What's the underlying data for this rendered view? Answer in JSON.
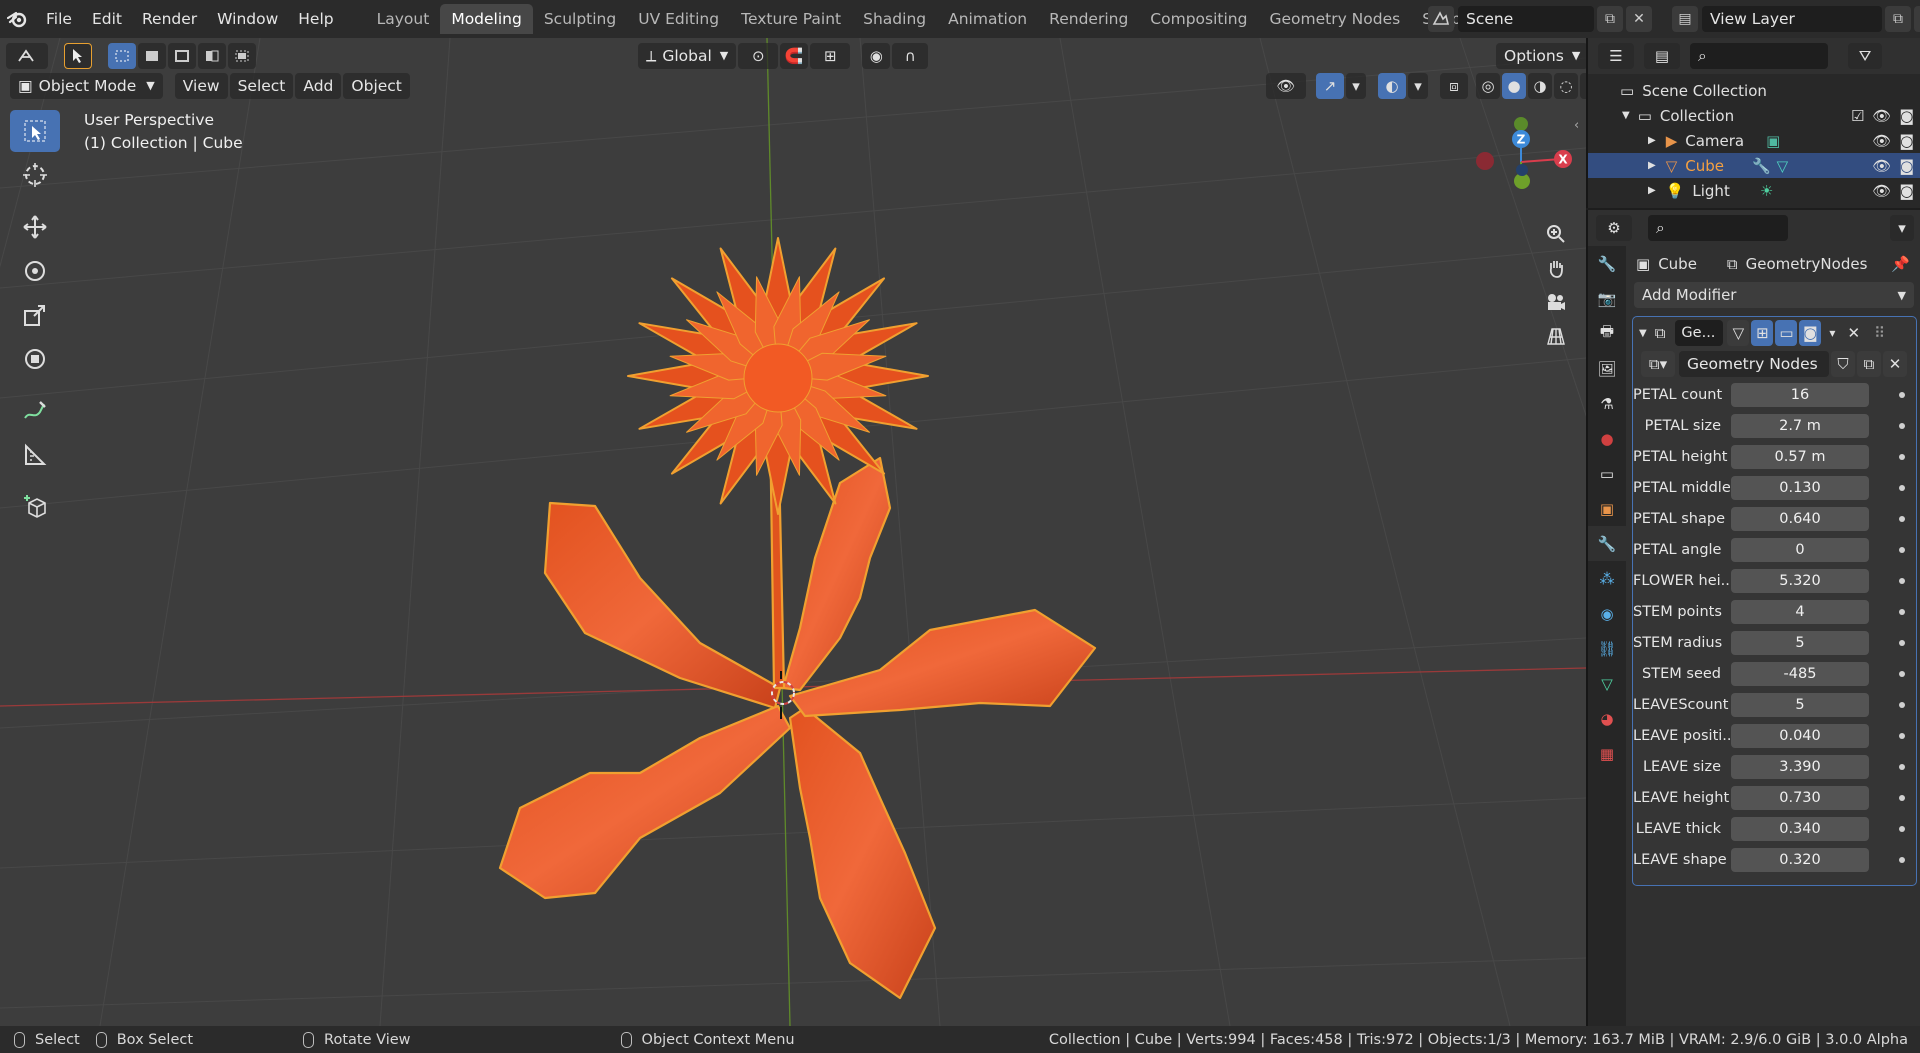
{
  "menubar": {
    "items": [
      "File",
      "Edit",
      "Render",
      "Window",
      "Help"
    ],
    "workspaces": [
      "Layout",
      "Modeling",
      "Sculpting",
      "UV Editing",
      "Texture Paint",
      "Shading",
      "Animation",
      "Rendering",
      "Compositing",
      "Geometry Nodes",
      "Scripting"
    ],
    "active_workspace": "Modeling",
    "add_workspace": "+",
    "scene_name": "Scene",
    "view_layer": "View Layer"
  },
  "viewport": {
    "transform_orientation": "Global",
    "options_label": "Options",
    "mode": "Object Mode",
    "menus": [
      "View",
      "Select",
      "Add",
      "Object"
    ],
    "overlay_line1": "User Perspective",
    "overlay_line2": "(1) Collection | Cube",
    "gizmo_axes": {
      "z": "Z",
      "x": "X"
    }
  },
  "outliner": {
    "root": "Scene Collection",
    "collection": "Collection",
    "objects": [
      {
        "name": "Camera",
        "selected": false
      },
      {
        "name": "Cube",
        "selected": true
      },
      {
        "name": "Light",
        "selected": false
      }
    ]
  },
  "properties": {
    "object_name": "Cube",
    "modifier_tab": "GeometryNodes",
    "add_modifier": "Add Modifier",
    "modifier_short_name": "Ge...",
    "node_group": "Geometry Nodes",
    "inputs": [
      {
        "label": "PETAL count",
        "value": "16"
      },
      {
        "label": "PETAL size",
        "value": "2.7 m"
      },
      {
        "label": "PETAL height",
        "value": "0.57 m"
      },
      {
        "label": "PETAL middle",
        "value": "0.130"
      },
      {
        "label": "PETAL shape",
        "value": "0.640"
      },
      {
        "label": "PETAL angle",
        "value": "0"
      },
      {
        "label": "FLOWER hei...",
        "value": "5.320"
      },
      {
        "label": "STEM points",
        "value": "4"
      },
      {
        "label": "STEM radius",
        "value": "5"
      },
      {
        "label": "STEM seed",
        "value": "-485"
      },
      {
        "label": "LEAVEScount",
        "value": "5"
      },
      {
        "label": "LEAVE positi...",
        "value": "0.040"
      },
      {
        "label": "LEAVE size",
        "value": "3.390"
      },
      {
        "label": "LEAVE height",
        "value": "0.730"
      },
      {
        "label": "LEAVE thick",
        "value": "0.340"
      },
      {
        "label": "LEAVE shape",
        "value": "0.320"
      }
    ]
  },
  "statusbar": {
    "select": "Select",
    "box_select": "Box Select",
    "rotate_view": "Rotate View",
    "context_menu": "Object Context Menu",
    "stats": "Collection | Cube | Verts:994 | Faces:458 | Tris:972 | Objects:1/3 | Memory: 163.7 MiB | VRAM: 2.9/6.0 GiB | 3.0.0 Alpha"
  },
  "colors": {
    "accent": "#4772b3",
    "selection_orange": "#f0a030",
    "flower": "#e8521e",
    "viewport_bg": "#3d3d3d"
  }
}
